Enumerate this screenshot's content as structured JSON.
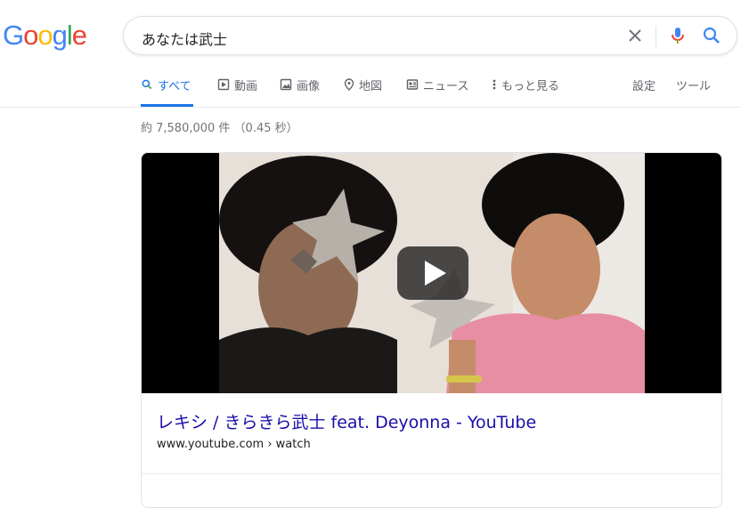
{
  "logo": {
    "letters": [
      "G",
      "o",
      "o",
      "g",
      "l",
      "e"
    ],
    "colors": [
      "#4285F4",
      "#EA4335",
      "#FBBC05",
      "#4285F4",
      "#34A853",
      "#EA4335"
    ]
  },
  "search": {
    "query": "あなたは武士",
    "icons": [
      "clear-icon",
      "mic-icon",
      "search-icon"
    ]
  },
  "tabs": {
    "items": [
      {
        "label": "すべて",
        "icon": "search-icon",
        "active": true
      },
      {
        "label": "動画",
        "icon": "play-icon"
      },
      {
        "label": "画像",
        "icon": "image-icon"
      },
      {
        "label": "地図",
        "icon": "map-pin-icon"
      },
      {
        "label": "ニュース",
        "icon": "news-icon"
      },
      {
        "label": "もっと見る",
        "icon": "more-vert-icon"
      }
    ],
    "settings": "設定",
    "tools": "ツール"
  },
  "stats": "約 7,580,000 件 （0.45 秒）",
  "result": {
    "title": "レキシ / きらきら武士 feat. Deyonna - YouTube",
    "url": "www.youtube.com › watch"
  },
  "colors": {
    "accent": "#1a73e8",
    "link": "#1a0dab",
    "muted": "#5f6368"
  }
}
